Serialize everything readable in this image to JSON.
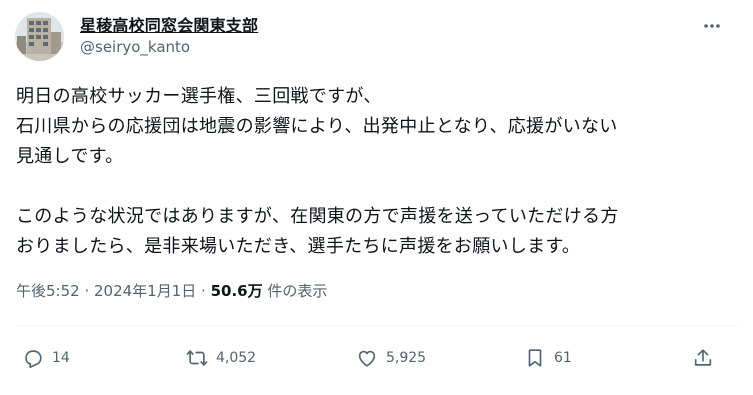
{
  "author": {
    "display_name": "星稜高校同窓会関東支部",
    "handle": "@seiryo_kanto",
    "avatar_icon": "building-avatar"
  },
  "header": {
    "more_icon": "more-dots-icon"
  },
  "tweet": {
    "lines": [
      "明日の高校サッカー選手権、三回戦ですが、",
      "石川県からの応援団は地震の影響により、出発中止となり、応援がいない",
      "見通しです。",
      "このような状況ではありますが、在関東の方で声援を送っていただける方",
      "おりましたら、是非来場いただき、選手たちに声援をお願いします。"
    ]
  },
  "meta": {
    "time": "午後5:52",
    "separator": " · ",
    "date": "2024年1月1日",
    "views_count": "50.6万",
    "views_label": " 件の表示"
  },
  "actions": {
    "reply": {
      "icon": "reply-icon",
      "count": "14"
    },
    "retweet": {
      "icon": "retweet-icon",
      "count": "4,052"
    },
    "like": {
      "icon": "heart-icon",
      "count": "5,925"
    },
    "bookmark": {
      "icon": "bookmark-icon",
      "count": "61"
    },
    "share": {
      "icon": "share-icon"
    }
  },
  "colors": {
    "text": "#0f1419",
    "secondary": "#536471",
    "divider": "#eff3f4"
  }
}
